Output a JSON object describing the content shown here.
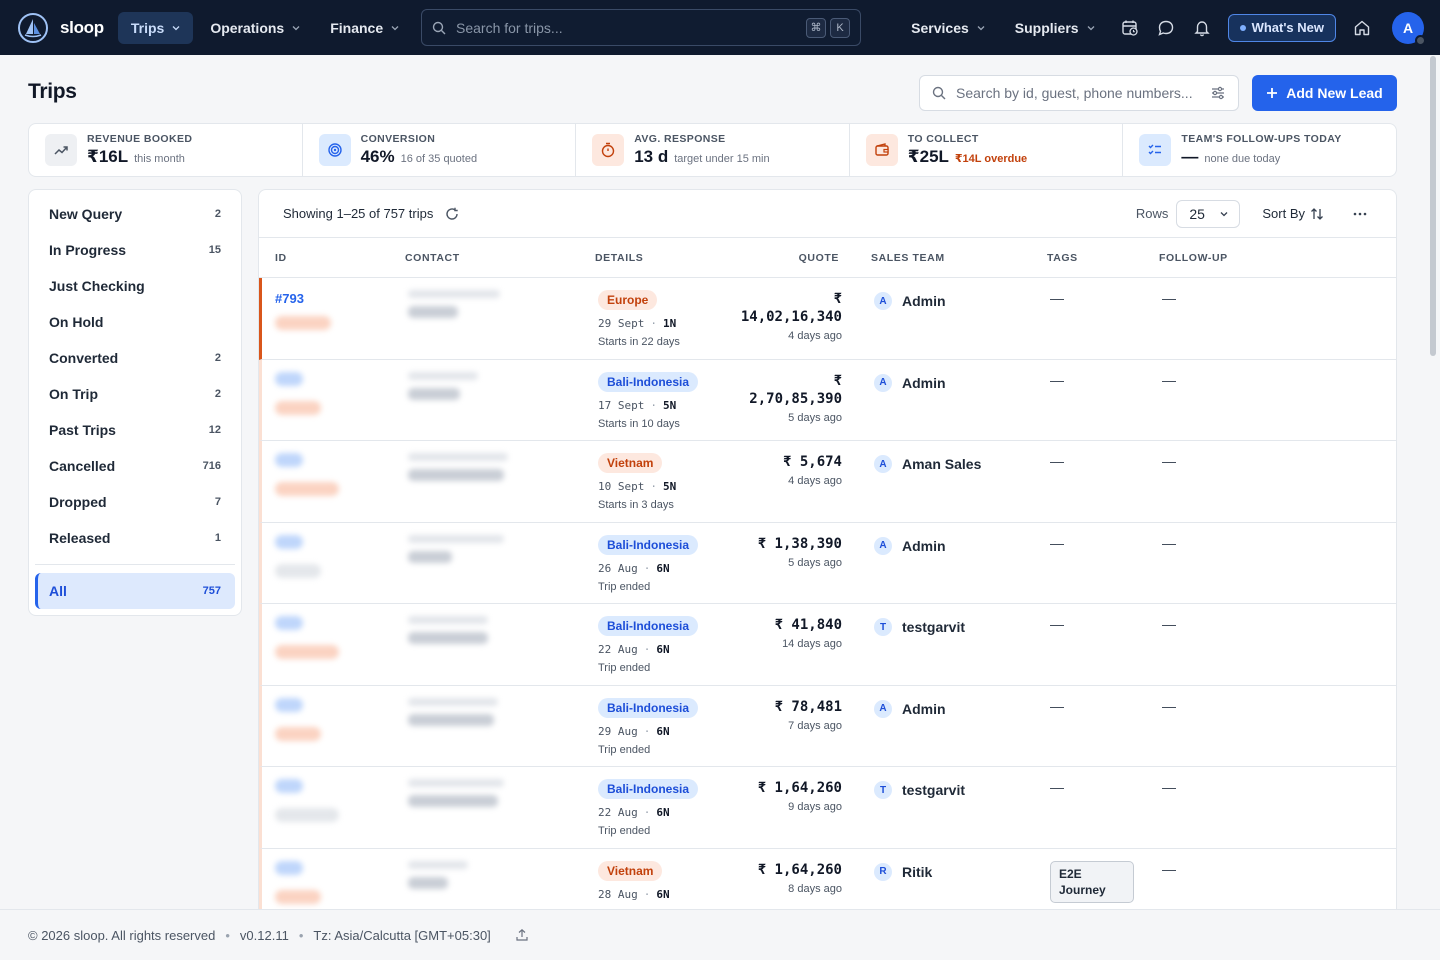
{
  "app": {
    "brand": "sloop"
  },
  "nav": {
    "items": [
      {
        "label": "Trips",
        "active": true
      },
      {
        "label": "Operations",
        "active": false
      },
      {
        "label": "Finance",
        "active": false
      }
    ],
    "search_placeholder": "Search for trips...",
    "shortcut_keys": [
      "⌘",
      "K"
    ],
    "right_items": [
      {
        "label": "Services"
      },
      {
        "label": "Suppliers"
      }
    ],
    "whats_new": "What's New",
    "avatar_initial": "A"
  },
  "page": {
    "title": "Trips",
    "lead_search_placeholder": "Search by id, guest, phone numbers...",
    "add_lead_label": "Add New Lead"
  },
  "stats": [
    {
      "label": "REVENUE BOOKED",
      "value": "₹16L",
      "sub": "this month",
      "sub_style": "normal",
      "icon": "trend-up-icon",
      "icon_bg": "#eef0f3",
      "icon_color": "#4b5563"
    },
    {
      "label": "CONVERSION",
      "value": "46%",
      "sub": "16 of 35 quoted",
      "sub_style": "normal",
      "icon": "target-icon",
      "icon_bg": "#dbeafe",
      "icon_color": "#2563eb"
    },
    {
      "label": "AVG. RESPONSE",
      "value": "13 d",
      "sub": "target under 15 min",
      "sub_style": "normal",
      "icon": "stopwatch-icon",
      "icon_bg": "#fde8df",
      "icon_color": "#c2410c"
    },
    {
      "label": "TO COLLECT",
      "value": "₹25L",
      "sub": "₹14L overdue",
      "sub_style": "red",
      "icon": "wallet-icon",
      "icon_bg": "#fde8df",
      "icon_color": "#c2410c"
    },
    {
      "label": "TEAM'S FOLLOW-UPS TODAY",
      "value": "—",
      "sub": "none due today",
      "sub_style": "normal",
      "icon": "checklist-icon",
      "icon_bg": "#dbeafe",
      "icon_color": "#2563eb"
    }
  ],
  "sidebar": {
    "items": [
      {
        "label": "New Query",
        "count": "2"
      },
      {
        "label": "In Progress",
        "count": "15"
      },
      {
        "label": "Just Checking",
        "count": ""
      },
      {
        "label": "On Hold",
        "count": ""
      },
      {
        "label": "Converted",
        "count": "2"
      },
      {
        "label": "On Trip",
        "count": "2"
      },
      {
        "label": "Past Trips",
        "count": "12"
      },
      {
        "label": "Cancelled",
        "count": "716"
      },
      {
        "label": "Dropped",
        "count": "7"
      },
      {
        "label": "Released",
        "count": "1"
      }
    ],
    "all": {
      "label": "All",
      "count": "757"
    }
  },
  "table": {
    "showing": "Showing 1–25 of 757 trips",
    "rows_label": "Rows",
    "rows_value": "25",
    "sort_label": "Sort By",
    "columns": [
      "ID",
      "CONTACT",
      "DETAILS",
      "QUOTE",
      "SALES TEAM",
      "TAGS",
      "FOLLOW-UP"
    ],
    "rows": [
      {
        "id": "#793",
        "destination": "Europe",
        "dest_type": "europe",
        "date": "29 Sept",
        "nights": "1N",
        "sub": "Starts in 22 days",
        "quote_line1": "₹",
        "quote_line2": "14,02,16,340",
        "ago": "4 days ago",
        "sales_initial": "A",
        "sales": "Admin",
        "tag": "—",
        "followup": "—"
      },
      {
        "id": "",
        "destination": "Bali-Indonesia",
        "dest_type": "bali",
        "date": "17 Sept",
        "nights": "5N",
        "sub": "Starts in 10 days",
        "quote_line1": "₹",
        "quote_line2": "2,70,85,390",
        "ago": "5 days ago",
        "sales_initial": "A",
        "sales": "Admin",
        "tag": "—",
        "followup": "—"
      },
      {
        "id": "",
        "destination": "Vietnam",
        "dest_type": "vietnam",
        "date": "10 Sept",
        "nights": "5N",
        "sub": "Starts in 3 days",
        "quote_line1": "",
        "quote_line2": "₹ 5,674",
        "ago": "4 days ago",
        "sales_initial": "A",
        "sales": "Aman Sales",
        "tag": "—",
        "followup": "—"
      },
      {
        "id": "",
        "destination": "Bali-Indonesia",
        "dest_type": "bali",
        "date": "26 Aug",
        "nights": "6N",
        "sub": "Trip ended",
        "quote_line1": "",
        "quote_line2": "₹ 1,38,390",
        "ago": "5 days ago",
        "sales_initial": "A",
        "sales": "Admin",
        "tag": "—",
        "followup": "—"
      },
      {
        "id": "",
        "destination": "Bali-Indonesia",
        "dest_type": "bali",
        "date": "22 Aug",
        "nights": "6N",
        "sub": "Trip ended",
        "quote_line1": "",
        "quote_line2": "₹ 41,840",
        "ago": "14 days ago",
        "sales_initial": "T",
        "sales": "testgarvit",
        "tag": "—",
        "followup": "—"
      },
      {
        "id": "",
        "destination": "Bali-Indonesia",
        "dest_type": "bali",
        "date": "29 Aug",
        "nights": "6N",
        "sub": "Trip ended",
        "quote_line1": "",
        "quote_line2": "₹ 78,481",
        "ago": "7 days ago",
        "sales_initial": "A",
        "sales": "Admin",
        "tag": "—",
        "followup": "—"
      },
      {
        "id": "",
        "destination": "Bali-Indonesia",
        "dest_type": "bali",
        "date": "22 Aug",
        "nights": "6N",
        "sub": "Trip ended",
        "quote_line1": "",
        "quote_line2": "₹ 1,64,260",
        "ago": "9 days ago",
        "sales_initial": "T",
        "sales": "testgarvit",
        "tag": "—",
        "followup": "—"
      },
      {
        "id": "",
        "destination": "Vietnam",
        "dest_type": "vietnam",
        "date": "28 Aug",
        "nights": "6N",
        "sub": "",
        "quote_line1": "",
        "quote_line2": "₹ 1,64,260",
        "ago": "8 days ago",
        "sales_initial": "R",
        "sales": "Ritik",
        "tag": "E2E Journey",
        "followup": "—"
      }
    ]
  },
  "footer": {
    "copyright": "© 2026 sloop. All rights reserved",
    "version": "v0.12.11",
    "timezone": "Tz: Asia/Calcutta [GMT+05:30]"
  }
}
